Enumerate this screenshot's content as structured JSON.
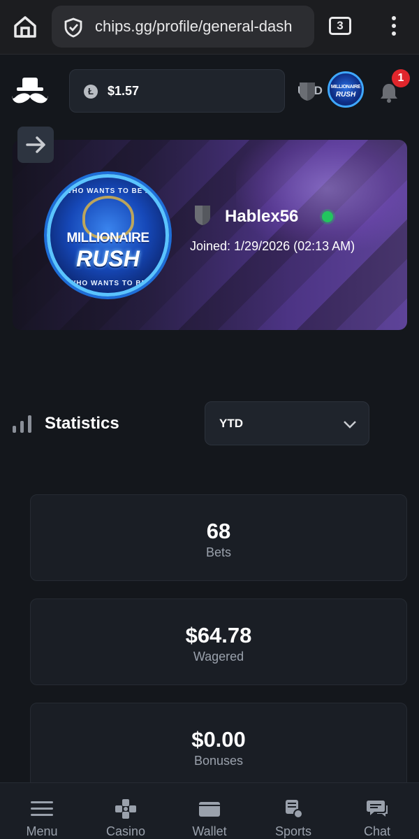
{
  "browser": {
    "url": "chips.gg/profile/general-dash",
    "tab_count": "3"
  },
  "header": {
    "balance": "$1.57",
    "coin_symbol": "Ł",
    "currency": "USD",
    "notification_count": "1",
    "avatar_line1": "MILLIONAIRE",
    "avatar_line2": "RUSH"
  },
  "profile": {
    "username": "Hablex56",
    "joined": "Joined: 1/29/2026 (02:13 AM)",
    "avatar_top_text": "WHO WANTS TO BE A",
    "avatar_bottom_text": "WHO WANTS TO BE",
    "avatar_word1": "MILLIONAIRE",
    "avatar_word2": "RUSH",
    "online_status_color": "#22c55e"
  },
  "statistics": {
    "title": "Statistics",
    "period": "YTD",
    "cards": [
      {
        "value": "68",
        "label": "Bets"
      },
      {
        "value": "$64.78",
        "label": "Wagered"
      },
      {
        "value": "$0.00",
        "label": "Bonuses"
      }
    ]
  },
  "bottom_nav": [
    {
      "label": "Menu",
      "icon": "menu-icon"
    },
    {
      "label": "Casino",
      "icon": "casino-icon"
    },
    {
      "label": "Wallet",
      "icon": "wallet-icon"
    },
    {
      "label": "Sports",
      "icon": "sports-icon"
    },
    {
      "label": "Chat",
      "icon": "chat-icon"
    }
  ],
  "colors": {
    "background": "#14171c",
    "card": "#1a1e25",
    "notification": "#e0262c",
    "online": "#22c55e"
  }
}
